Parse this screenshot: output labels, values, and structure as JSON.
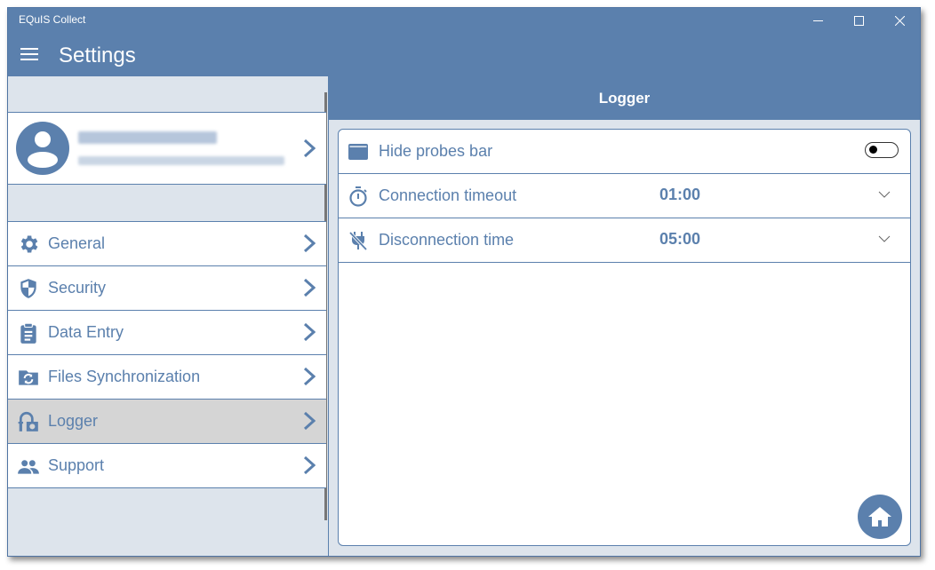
{
  "window": {
    "app_title": "EQuIS Collect",
    "controls": {
      "minimize": "minimize-icon",
      "maximize": "maximize-icon",
      "close": "close-icon"
    }
  },
  "header": {
    "menu_icon": "hamburger-icon",
    "title": "Settings"
  },
  "profile": {
    "avatar_icon": "user-avatar-icon",
    "name": "(blurred)",
    "email": "(blurred)",
    "chevron_icon": "chevron-right-icon"
  },
  "sidebar": {
    "items": [
      {
        "label": "General",
        "icon": "gear-icon",
        "active": false
      },
      {
        "label": "Security",
        "icon": "shield-icon",
        "active": false
      },
      {
        "label": "Data Entry",
        "icon": "clipboard-icon",
        "active": false
      },
      {
        "label": "Files Synchronization",
        "icon": "folder-sync-icon",
        "active": false
      },
      {
        "label": "Logger",
        "icon": "logger-icon",
        "active": true
      },
      {
        "label": "Support",
        "icon": "people-icon",
        "active": false
      }
    ]
  },
  "content": {
    "title": "Logger",
    "settings": [
      {
        "label": "Hide probes bar",
        "icon": "window-bar-icon",
        "type": "toggle",
        "value": false
      },
      {
        "label": "Connection timeout",
        "icon": "stopwatch-icon",
        "type": "dropdown",
        "value": "01:00"
      },
      {
        "label": "Disconnection time",
        "icon": "unplug-icon",
        "type": "dropdown",
        "value": "05:00"
      }
    ],
    "home_button_icon": "home-icon"
  },
  "colors": {
    "accent": "#5b80ad",
    "background": "#dde4ec",
    "active_item": "#d5d5d5"
  }
}
